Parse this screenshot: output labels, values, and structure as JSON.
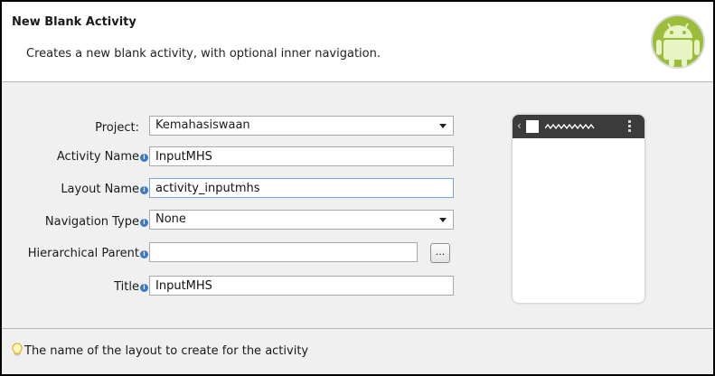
{
  "header": {
    "title": "New Blank Activity",
    "description": "Creates a new blank activity, with optional inner navigation.",
    "logo_icon": "android-logo-icon"
  },
  "form": {
    "project": {
      "label": "Project:",
      "value": "Kemahasiswaan"
    },
    "activity_name": {
      "label": "Activity Name",
      "value": "InputMHS"
    },
    "layout_name": {
      "label": "Layout Name",
      "value": "activity_inputmhs"
    },
    "navigation_type": {
      "label": "Navigation Type",
      "value": "None"
    },
    "hierarchical_parent": {
      "label": "Hierarchical Parent",
      "value": "",
      "browse_label": "..."
    },
    "title": {
      "label": "Title",
      "value": "InputMHS"
    },
    "info_glyph": "i"
  },
  "preview": {
    "back_glyph": "‹"
  },
  "status": {
    "message": "The name of the layout to create for the activity",
    "icon": "lightbulb-icon"
  },
  "colors": {
    "accent": "#a4c639",
    "info": "#3c78c8",
    "actionbar": "#3b3b3b"
  }
}
